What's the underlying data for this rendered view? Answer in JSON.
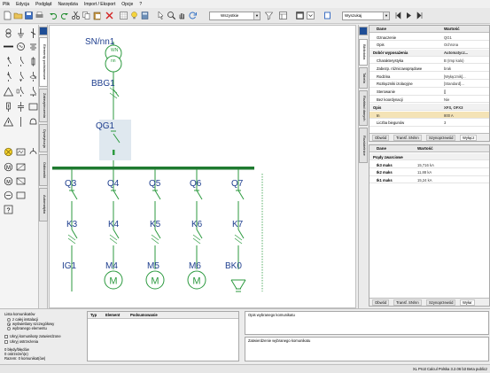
{
  "menu": [
    "Plik",
    "Edycja",
    "Podgląd",
    "Narzędzia",
    "Import / Eksport",
    "Opcje",
    "?"
  ],
  "toolbar": {
    "filter_value": "Wszystkie",
    "search_value": "Wyszukaj"
  },
  "palette": {
    "tabs": [
      "Elementy podstawowe",
      "Zabezpieczenia",
      "Dystrybucja",
      "Odbiorniki",
      "Automatyka"
    ]
  },
  "diagram": {
    "source_label": "SN/nn1",
    "source_inner_top": "WN",
    "source_inner_bottom": "nn",
    "feeder_breaker": "BBG1",
    "main_breaker": "QG1",
    "outgoing_breakers": [
      "Q3",
      "Q4",
      "Q5",
      "Q6",
      "Q7"
    ],
    "contactors": [
      "K3",
      "K4",
      "K5",
      "K6",
      "K7"
    ],
    "loads": [
      "IG1",
      "M4",
      "M5",
      "M6",
      "BK0"
    ],
    "motor_symbol": "M"
  },
  "right_tabs": [
    "Bibliotoka",
    "Tabela",
    "Rozkład danych",
    "Rozdzielnice"
  ],
  "properties": {
    "col_name": "Dane",
    "col_value": "Wartość",
    "rows": [
      {
        "name": "Oznaczenie",
        "value": "QG1",
        "kind": "plain"
      },
      {
        "name": "Opis",
        "value": "Ochrona",
        "kind": "plain"
      },
      {
        "name": "Dobór wyposażenia",
        "value": "Automatycz...",
        "kind": "group"
      },
      {
        "name": "Charakterystyka",
        "value": "B (Imp kalo)",
        "kind": "plain"
      },
      {
        "name": "Zabezp. różnicowoprądowe",
        "value": "brak",
        "kind": "plain"
      },
      {
        "name": "Rodzina",
        "value": "[Wyłącznik]...",
        "kind": "plain"
      },
      {
        "name": "Rozłączniki izolacyjne",
        "value": "[Standard]...",
        "kind": "plain"
      },
      {
        "name": "Sterowanie",
        "value": "[]",
        "kind": "plain"
      },
      {
        "name": "Bez koordynacji",
        "value": "Nie",
        "kind": "plain"
      },
      {
        "name": "Opis",
        "value": "XFS, OFX3",
        "kind": "group"
      },
      {
        "name": "In",
        "value": "800 A",
        "kind": "selected"
      },
      {
        "name": "Liczba biegunów",
        "value": "3",
        "kind": "plain"
      }
    ],
    "tabs": [
      "Obwód",
      "Transf. SN/nn",
      "Szynoprzewód",
      "Wyłącz"
    ]
  },
  "results": {
    "col_name": "Dane",
    "col_value": "Wartość",
    "group": "Prądy zwarciowe",
    "rows": [
      {
        "name": "Ik3 maks",
        "value": "15,716 kA"
      },
      {
        "name": "Ik2 maks",
        "value": "11,88 kA"
      },
      {
        "name": "Ik1 maks",
        "value": "15,24 kA"
      }
    ],
    "tabs": [
      "Obwód",
      "Transf. SN/nn",
      "Szynoprzewód",
      "Wyłar"
    ]
  },
  "messages": {
    "group_title": "Lista komunikatów",
    "options": [
      "z całej instalacji",
      "wyświetlany szczegółowy",
      "wybranego elementu"
    ],
    "checks": [
      "Ukryj komunikaty zatwierdzone",
      "Ukryj ostrzeżenia"
    ],
    "count_errors": "0 błędy/błędów",
    "count_warnings": "0 ostrzeżeń(e)",
    "count_total": "Razem: 0 komunikat(ów)",
    "columns": [
      "Typ",
      "Element",
      "Podsumowanie"
    ],
    "desc_title": "Opis wybranego komunikatu",
    "approve_title": "Zatwierdzenie wybranego komunikatu"
  },
  "status": "XL Pro3 Calcul Polska 3.2.06  b3 Beta publicz"
}
